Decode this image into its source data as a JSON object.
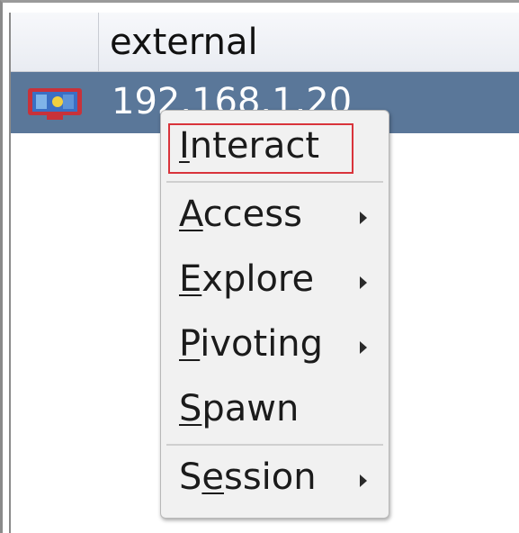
{
  "table": {
    "header_label": "external",
    "row": {
      "ip": "192.168.1.20",
      "icon": "windows-host-icon"
    }
  },
  "menu": {
    "items": [
      {
        "pre": "",
        "key": "I",
        "post": "nteract",
        "submenu": false
      },
      {
        "pre": "",
        "key": "A",
        "post": "ccess",
        "submenu": true
      },
      {
        "pre": "",
        "key": "E",
        "post": "xplore",
        "submenu": true
      },
      {
        "pre": "",
        "key": "P",
        "post": "ivoting",
        "submenu": true
      },
      {
        "pre": "",
        "key": "S",
        "post": "pawn",
        "submenu": false
      },
      {
        "pre": "S",
        "key": "e",
        "post": "ssion",
        "submenu": true
      }
    ]
  },
  "colors": {
    "selected_row": "#5a7799",
    "highlight_box": "#d9343b"
  }
}
